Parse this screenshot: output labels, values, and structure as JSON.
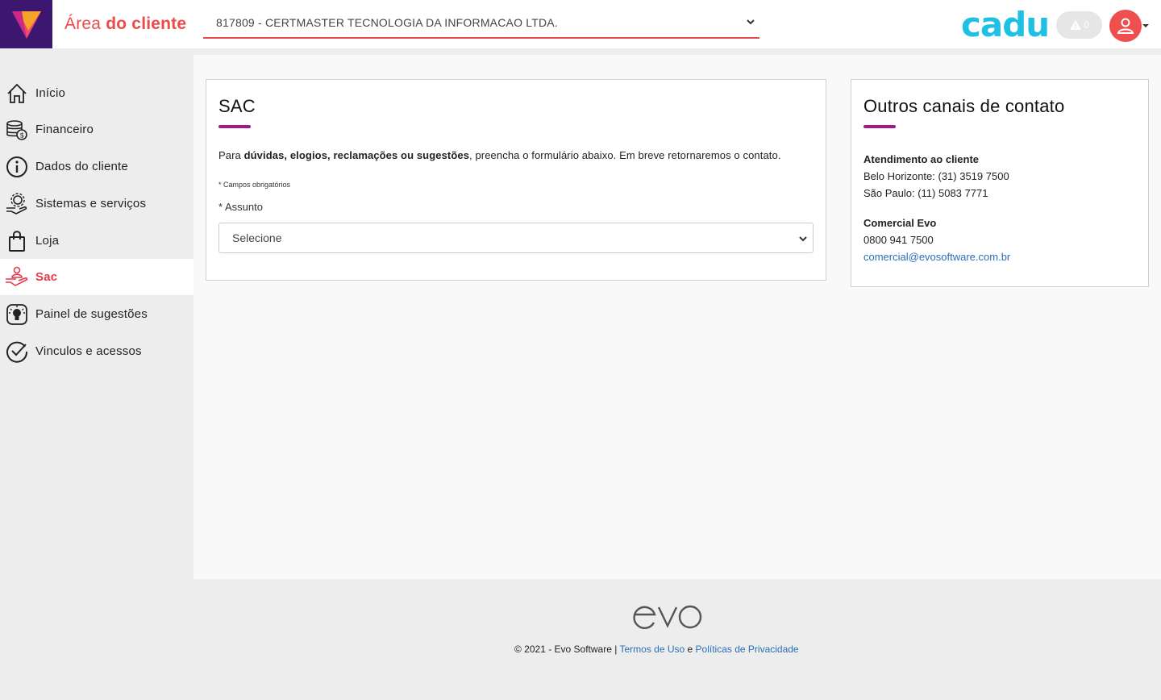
{
  "header": {
    "title_prefix": "Área",
    "title_strong": "do cliente",
    "company_selected": "817809 - CERTMASTER TECNOLOGIA DA INFORMACAO LTDA.",
    "brand": "cadu",
    "alert_count": "0"
  },
  "sidebar": {
    "items": [
      {
        "label": "Início",
        "icon": "home-icon"
      },
      {
        "label": "Financeiro",
        "icon": "coins-icon"
      },
      {
        "label": "Dados do cliente",
        "icon": "info-icon"
      },
      {
        "label": "Sistemas e serviços",
        "icon": "gear-hand-icon"
      },
      {
        "label": "Loja",
        "icon": "shopping-bag-icon"
      },
      {
        "label": "Sac",
        "icon": "support-hand-icon",
        "active": true
      },
      {
        "label": "Painel de sugestões",
        "icon": "lightbulb-icon"
      },
      {
        "label": "Vinculos e acessos",
        "icon": "check-circle-icon"
      }
    ]
  },
  "sac": {
    "title": "SAC",
    "intro_pre": "Para ",
    "intro_bold": "dúvidas, elogios, reclamações ou sugestões",
    "intro_post": ", preencha o formulário abaixo. Em breve retornaremos o contato.",
    "required_note": "* Campos obrigatórios",
    "subject_label": "* Assunto",
    "subject_placeholder": "Selecione"
  },
  "other_channels": {
    "title": "Outros canais de contato",
    "support_title": "Atendimento ao cliente",
    "support_bh": "Belo Horizonte: (31) 3519 7500",
    "support_sp": "São Paulo: (11) 5083 7771",
    "commercial_title": "Comercial Evo",
    "commercial_phone": "0800 941 7500",
    "commercial_email": "comercial@evosoftware.com.br"
  },
  "footer": {
    "copyright": "© 2021 - Evo Software | ",
    "terms": "Termos de Uso",
    "and": " e ",
    "privacy": "Políticas de Privacidade"
  },
  "colors": {
    "accent_red": "#ef4a4a",
    "accent_purple": "#a3188f",
    "brand_cyan": "#1ec1e4",
    "link_blue": "#2a6fb8"
  }
}
